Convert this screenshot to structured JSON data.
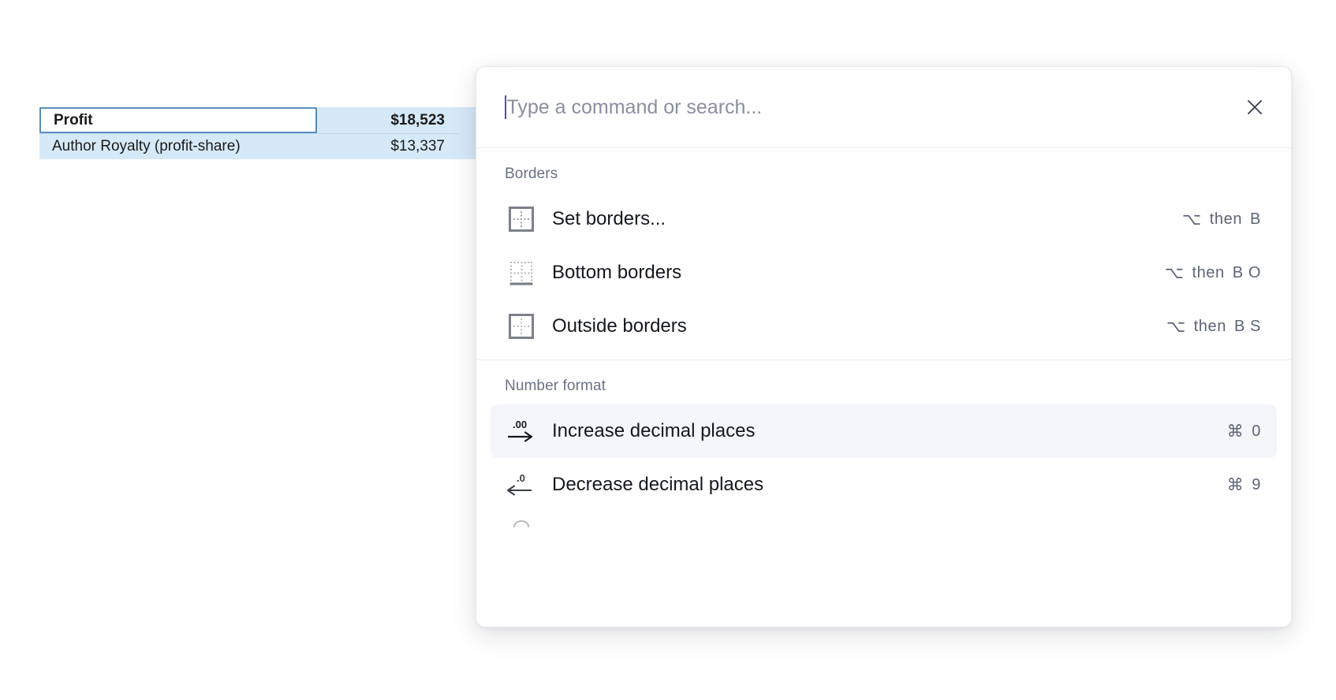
{
  "spreadsheet": {
    "rows": [
      {
        "label": "Profit",
        "value": "$18,523",
        "bold": true,
        "active": true
      },
      {
        "label": "Author Royalty (profit-share)",
        "value": "$13,337",
        "bold": false,
        "active": false
      }
    ],
    "selection_fill": "#d6e9f8",
    "active_cell_border": "#5b8dbe"
  },
  "palette": {
    "search": {
      "value": "",
      "placeholder": "Type a command or search...",
      "caret_color": "#4b4fbf"
    },
    "close_label": "close-icon",
    "groups": [
      {
        "title": "Borders",
        "items": [
          {
            "icon": "set-borders-icon",
            "label": "Set borders...",
            "shortcut_modifier": "⌥",
            "shortcut_word": "then",
            "shortcut_keys": "B",
            "active": false
          },
          {
            "icon": "bottom-borders-icon",
            "label": "Bottom borders",
            "shortcut_modifier": "⌥",
            "shortcut_word": "then",
            "shortcut_keys": "B O",
            "active": false
          },
          {
            "icon": "outside-borders-icon",
            "label": "Outside borders",
            "shortcut_modifier": "⌥",
            "shortcut_word": "then",
            "shortcut_keys": "B S",
            "active": false
          }
        ]
      },
      {
        "title": "Number format",
        "items": [
          {
            "icon": "increase-decimal-icon",
            "label": "Increase decimal places",
            "shortcut_modifier": "⌘",
            "shortcut_word": "",
            "shortcut_keys": "0",
            "active": true,
            "icon_text": ".00"
          },
          {
            "icon": "decrease-decimal-icon",
            "label": "Decrease decimal places",
            "shortcut_modifier": "⌘",
            "shortcut_word": "",
            "shortcut_keys": "9",
            "active": false,
            "icon_text": ".0"
          }
        ]
      }
    ],
    "highlight_color": "#f4f6fa",
    "group_label_color": "#6b7183"
  }
}
